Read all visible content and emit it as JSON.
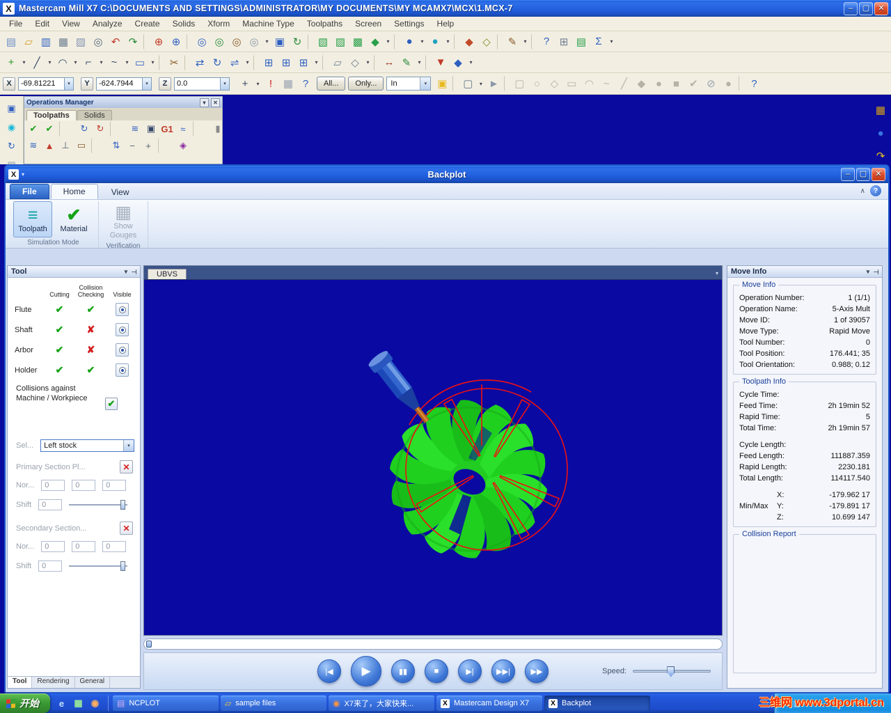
{
  "glyphs": {
    "dd": "▾",
    "pin": "⊤",
    "chevron": "∧",
    "help": "?",
    "min": "–",
    "max": "▢",
    "close": "✕",
    "logo": "X",
    "qa_arrow": "▾",
    "check": "✔"
  },
  "main_window": {
    "title": "Mastercam Mill X7   C:\\DOCUMENTS AND SETTINGS\\ADMINISTRATOR\\MY DOCUMENTS\\MY MCAMX7\\MCX\\1.MCX-7",
    "menus": [
      "File",
      "Edit",
      "View",
      "Analyze",
      "Create",
      "Solids",
      "Xform",
      "Machine Type",
      "Toolpaths",
      "Screen",
      "Settings",
      "Help"
    ]
  },
  "toolbars": {
    "row1": [
      {
        "name": "new-file-button",
        "glyph": "▤",
        "color": "#6f8fc9"
      },
      {
        "name": "open-file-button",
        "glyph": "▱",
        "color": "#d79a2b"
      },
      {
        "name": "save-button",
        "glyph": "▥",
        "color": "#2f5fc0"
      },
      {
        "name": "print-button",
        "glyph": "▦",
        "color": "#6d7d90"
      },
      {
        "name": "copy-button",
        "glyph": "▨",
        "color": "#8795b5"
      },
      {
        "name": "find-button",
        "glyph": "◎",
        "color": "#55657a"
      },
      {
        "name": "undo-button",
        "glyph": "↶",
        "color": "#c23a2a"
      },
      {
        "name": "redo-button",
        "glyph": "↷",
        "color": "#2a8a3a"
      },
      {
        "cls": "sep",
        "name": "toolbar-separator"
      },
      {
        "name": "analyze-position-button",
        "glyph": "⊕",
        "color": "#c23a2a"
      },
      {
        "name": "analyze-entity-button",
        "glyph": "⊕",
        "color": "#2f5fc0"
      },
      {
        "cls": "sep",
        "name": "toolbar-separator"
      },
      {
        "name": "zoom-window-button",
        "glyph": "◎",
        "color": "#2f5fc0"
      },
      {
        "name": "zoom-in-button",
        "glyph": "◎",
        "color": "#2a8a3a"
      },
      {
        "name": "zoom-out-button",
        "glyph": "◎",
        "color": "#8a5a2a"
      },
      {
        "name": "unzoom-button",
        "glyph": "◎",
        "color": "#8b98a8"
      },
      {
        "cls": "dd",
        "name": "zoom-dropdown",
        "glyph": "▾"
      },
      {
        "name": "fit-screen-button",
        "glyph": "▣",
        "color": "#2f5fc0"
      },
      {
        "name": "repaint-button",
        "glyph": "↻",
        "color": "#2a8a3a"
      },
      {
        "cls": "sep",
        "name": "toolbar-separator"
      },
      {
        "name": "gview-top-button",
        "glyph": "▧",
        "color": "#2aa04a"
      },
      {
        "name": "gview-front-button",
        "glyph": "▨",
        "color": "#2aa04a"
      },
      {
        "name": "gview-side-button",
        "glyph": "▩",
        "color": "#2aa04a"
      },
      {
        "name": "gview-iso-button",
        "glyph": "◆",
        "color": "#2aa04a"
      },
      {
        "cls": "dd",
        "name": "gview-dropdown",
        "glyph": "▾"
      },
      {
        "cls": "sep",
        "name": "toolbar-separator"
      },
      {
        "name": "planes-button",
        "glyph": "●",
        "color": "#2f5fc0"
      },
      {
        "cls": "dd",
        "name": "planes-dropdown",
        "glyph": "▾"
      },
      {
        "name": "wcs-button",
        "glyph": "●",
        "color": "#20a0c0"
      },
      {
        "cls": "dd",
        "name": "wcs-dropdown",
        "glyph": "▾"
      },
      {
        "cls": "sep",
        "name": "toolbar-separator"
      },
      {
        "name": "shading-button",
        "glyph": "◆",
        "color": "#c24a2a"
      },
      {
        "name": "wireframe-button",
        "glyph": "◇",
        "color": "#8a8a2a"
      },
      {
        "cls": "sep",
        "name": "toolbar-separator"
      },
      {
        "name": "attributes-button",
        "glyph": "✎",
        "color": "#8a5a2a"
      },
      {
        "cls": "dd",
        "name": "attributes-dropdown",
        "glyph": "▾"
      },
      {
        "cls": "sep",
        "name": "toolbar-separator"
      },
      {
        "name": "help-button",
        "glyph": "?",
        "color": "#2f5fc0"
      },
      {
        "name": "grid-params-button",
        "glyph": "⊞",
        "color": "#6d7d90"
      },
      {
        "name": "mcx-utility-button",
        "glyph": "▤",
        "color": "#2aa04a"
      },
      {
        "name": "sigma-button",
        "glyph": "Σ",
        "color": "#2f5fc0"
      },
      {
        "cls": "dd",
        "name": "more-dropdown",
        "glyph": "▾"
      }
    ],
    "row2": [
      {
        "name": "create-point-button",
        "glyph": "+",
        "color": "#2a9a2a"
      },
      {
        "cls": "dd",
        "name": "create-point-dropdown",
        "glyph": "▾"
      },
      {
        "name": "create-line-button",
        "glyph": "╱",
        "color": "#35486a"
      },
      {
        "cls": "dd",
        "name": "create-line-dropdown",
        "glyph": "▾"
      },
      {
        "name": "create-arc-button",
        "glyph": "◠",
        "color": "#35486a"
      },
      {
        "cls": "dd",
        "name": "create-arc-dropdown",
        "glyph": "▾"
      },
      {
        "name": "create-fillet-button",
        "glyph": "⌐",
        "color": "#35486a"
      },
      {
        "cls": "dd",
        "name": "create-fillet-dropdown",
        "glyph": "▾"
      },
      {
        "name": "create-spline-button",
        "glyph": "~",
        "color": "#35486a"
      },
      {
        "cls": "dd",
        "name": "create-spline-dropdown",
        "glyph": "▾"
      },
      {
        "name": "create-rect-button",
        "glyph": "▭",
        "color": "#2f5fc0"
      },
      {
        "cls": "dd",
        "name": "create-rect-dropdown",
        "glyph": "▾"
      },
      {
        "cls": "sep",
        "name": "toolbar-separator"
      },
      {
        "name": "trim-button",
        "glyph": "✂",
        "color": "#8a5a2a"
      },
      {
        "cls": "sep",
        "name": "toolbar-separator"
      },
      {
        "name": "xform-translate-button",
        "glyph": "⇄",
        "color": "#2f5fc0"
      },
      {
        "name": "xform-rotate-button",
        "glyph": "↻",
        "color": "#2f5fc0"
      },
      {
        "name": "xform-mirror-button",
        "glyph": "⇌",
        "color": "#2f5fc0"
      },
      {
        "cls": "dd",
        "name": "xform-dropdown",
        "glyph": "▾"
      },
      {
        "cls": "sep",
        "name": "toolbar-separator"
      },
      {
        "name": "levels-button",
        "glyph": "⊞",
        "color": "#2f5fc0"
      },
      {
        "name": "level-manager-button",
        "glyph": "⊞",
        "color": "#2f5fc0"
      },
      {
        "name": "level-set-button",
        "glyph": "⊞",
        "color": "#2f5fc0"
      },
      {
        "cls": "dd",
        "name": "levels-dropdown",
        "glyph": "▾"
      },
      {
        "cls": "sep",
        "name": "toolbar-separator"
      },
      {
        "name": "cplane-button",
        "glyph": "▱",
        "color": "#6d7d90"
      },
      {
        "name": "vplane-button",
        "glyph": "◇",
        "color": "#6d7d90"
      },
      {
        "cls": "dd",
        "name": "plane-dropdown",
        "glyph": "▾"
      },
      {
        "cls": "sep",
        "name": "toolbar-separator"
      },
      {
        "name": "dimension-button",
        "glyph": "↔",
        "color": "#a23a2a"
      },
      {
        "name": "note-button",
        "glyph": "✎",
        "color": "#2a8a3a"
      },
      {
        "cls": "dd",
        "name": "drafting-dropdown",
        "glyph": "▾"
      },
      {
        "cls": "sep",
        "name": "toolbar-separator"
      },
      {
        "name": "solids-button",
        "glyph": "▼",
        "color": "#c23a2a"
      },
      {
        "name": "surface-button",
        "glyph": "◆",
        "color": "#2f5fc0"
      },
      {
        "cls": "dd",
        "name": "model-dropdown",
        "glyph": "▾"
      }
    ],
    "coord": {
      "x_label": "X",
      "x_value": "-69.81221",
      "y_label": "Y",
      "y_value": "-624.7944",
      "z_label": "Z",
      "z_value": "0.0",
      "all_button": "All...",
      "only_button": "Only...",
      "in_value": "In"
    },
    "coord_icons": [
      {
        "name": "autocursor-button",
        "glyph": "+",
        "color": "#35486a"
      },
      {
        "cls": "dd",
        "name": "autocursor-dropdown",
        "glyph": "▾"
      },
      {
        "name": "fastpoint-button",
        "glyph": "!",
        "color": "#d02020"
      },
      {
        "name": "grid-toggle-button",
        "glyph": "▦",
        "color": "#98a2b0"
      },
      {
        "name": "config-button",
        "glyph": "?",
        "color": "#2f5fc0"
      }
    ],
    "select_icons": [
      {
        "name": "highlight-button",
        "glyph": "▣",
        "color": "#e8b820"
      },
      {
        "cls": "sep",
        "name": "toolbar-separator"
      },
      {
        "name": "select-box-button",
        "glyph": "▢",
        "color": "#66788c"
      },
      {
        "cls": "dd",
        "name": "select-box-dropdown",
        "glyph": "▾"
      },
      {
        "name": "select-cursor-button",
        "glyph": "►",
        "color": "#8b98a8"
      },
      {
        "cls": "sep",
        "name": "toolbar-separator"
      },
      {
        "name": "filter-square-button",
        "glyph": "▢",
        "color": "#b6b2a4"
      },
      {
        "name": "filter-circle-button",
        "glyph": "○",
        "color": "#b6b2a4"
      },
      {
        "name": "filter-diamond-button",
        "glyph": "◇",
        "color": "#b6b2a4"
      },
      {
        "name": "filter-rect-button",
        "glyph": "▭",
        "color": "#b6b2a4"
      },
      {
        "name": "filter-arc-button",
        "glyph": "◠",
        "color": "#b6b2a4"
      },
      {
        "name": "filter-spline-button",
        "glyph": "~",
        "color": "#b6b2a4"
      },
      {
        "name": "filter-line-button",
        "glyph": "╱",
        "color": "#b6b2a4"
      },
      {
        "name": "filter-solid-button",
        "glyph": "◆",
        "color": "#b6b2a4"
      },
      {
        "name": "filter-surface-button",
        "glyph": "●",
        "color": "#b6b2a4"
      },
      {
        "name": "filter-wire-button",
        "glyph": "■",
        "color": "#b6b2a4"
      },
      {
        "name": "select-last-button",
        "glyph": "✔",
        "color": "#b6b2a4"
      },
      {
        "name": "clear-selection-button",
        "glyph": "⊘",
        "color": "#98a2b0"
      },
      {
        "name": "select-solids-button",
        "glyph": "●",
        "color": "#b6b2a4"
      },
      {
        "cls": "sep",
        "name": "toolbar-separator"
      },
      {
        "name": "selection-help-button",
        "glyph": "?",
        "color": "#2f5fc0"
      }
    ]
  },
  "left_strip": [
    {
      "name": "dock-view-button",
      "glyph": "▣",
      "color": "#2f5fc0"
    },
    {
      "name": "dock-wcs-button",
      "glyph": "◉",
      "color": "#18b8d8"
    },
    {
      "name": "dock-rotate-button",
      "glyph": "↻",
      "color": "#2f5fc0"
    },
    {
      "name": "dock-layers-button",
      "glyph": "▤",
      "color": "#8b98a8"
    }
  ],
  "right_strip": [
    {
      "name": "float-grid-button",
      "glyph": "▦",
      "color": "#d4a017"
    },
    {
      "name": "float-sphere-button",
      "glyph": "●",
      "color": "#3a72e0"
    },
    {
      "name": "float-arrow-button",
      "glyph": "↷",
      "color": "#e8c020"
    }
  ],
  "ops_manager": {
    "title": "Operations Manager",
    "tabs": [
      "Toolpaths",
      "Solids"
    ],
    "toolbar1": [
      {
        "name": "select-all-operations-button",
        "glyph": "✔",
        "color": "#18a018"
      },
      {
        "name": "select-operations-button",
        "glyph": "✔",
        "color": "#18a018"
      },
      {
        "cls": "sep",
        "name": "toolbar-separator"
      },
      {
        "name": "regen-all-button",
        "glyph": "↻",
        "color": "#2f5fc0"
      },
      {
        "name": "regen-dirty-button",
        "glyph": "↻",
        "color": "#c23a2a"
      },
      {
        "cls": "sep",
        "name": "toolbar-separator"
      },
      {
        "name": "backplot-ops-button",
        "glyph": "≋",
        "color": "#2f5fc0"
      },
      {
        "name": "verify-button",
        "glyph": "▣",
        "color": "#35486a"
      },
      {
        "cls": "txt",
        "name": "post-button",
        "glyph": "G1",
        "color": "#c23a2a"
      },
      {
        "name": "highfeed-button",
        "glyph": "≈",
        "color": "#2f5fc0"
      },
      {
        "cls": "sep",
        "name": "toolbar-separator"
      },
      {
        "name": "toolpath-lock-button",
        "glyph": "▮",
        "color": "#8a8a8a"
      },
      {
        "name": "toolpath-display-button",
        "glyph": "≡",
        "color": "#35486a"
      },
      {
        "name": "delete-operations-button",
        "glyph": "✕",
        "color": "#c23a2a"
      },
      {
        "name": "ops-help-button",
        "glyph": "?",
        "color": "#2f5fc0"
      }
    ],
    "toolbar2": [
      {
        "name": "geometry-button",
        "glyph": "≋",
        "color": "#2f5fc0"
      },
      {
        "name": "parameters-button",
        "glyph": "▲",
        "color": "#c23a2a"
      },
      {
        "name": "tool-settings-button",
        "glyph": "⊥",
        "color": "#556070"
      },
      {
        "name": "stock-button",
        "glyph": "▭",
        "color": "#8a5a2a"
      },
      {
        "cls": "sep",
        "name": "toolbar-separator"
      },
      {
        "name": "sort-button",
        "glyph": "⇅",
        "color": "#2f5fc0"
      },
      {
        "name": "collapse-button",
        "glyph": "−",
        "color": "#556070"
      },
      {
        "name": "expand-button",
        "glyph": "+",
        "color": "#556070"
      },
      {
        "cls": "sep",
        "name": "toolbar-separator"
      },
      {
        "name": "info-button",
        "glyph": "◈",
        "color": "#8a2aa0"
      }
    ]
  },
  "backplot": {
    "title": "Backplot",
    "ribbon_tabs": [
      "File",
      "Home",
      "View"
    ],
    "ribbon": {
      "toolpath_icon": "≡",
      "toolpath_label": "Toolpath",
      "material_icon": "✔",
      "material_label": "Material",
      "gouges_icon": "▦",
      "show_gouges_label": "Show Gouges",
      "group_simulation": "Simulation Mode",
      "group_verification": "Verification"
    },
    "tool_panel": {
      "title": "Tool",
      "columns": [
        "Cutting",
        "Collision Checking",
        "Visible"
      ],
      "rows": [
        {
          "label": "Flute",
          "cutting": true,
          "collision": true
        },
        {
          "label": "Shaft",
          "cutting": true,
          "collision": false
        },
        {
          "label": "Arbor",
          "cutting": true,
          "collision": false
        },
        {
          "label": "Holder",
          "cutting": true,
          "collision": true
        }
      ],
      "collisions_text": "Collisions against Machine / Workpiece",
      "collisions_checked": true,
      "select_label": "Sel...",
      "stock_value": "Left stock",
      "primary_section_label": "Primary Section Pl...",
      "nor_label": "Nor...",
      "shift_label": "Shift",
      "field_zero": "0",
      "secondary_section_label": "Secondary Section...",
      "tabs": [
        "Tool",
        "Rendering",
        "General"
      ]
    },
    "viewport": {
      "tab": "UBVS"
    },
    "playback": {
      "buttons": [
        {
          "name": "skip-start-button",
          "glyph": "|◀"
        },
        {
          "name": "play-button",
          "glyph": "▶",
          "cls": "big"
        },
        {
          "name": "pause-button",
          "glyph": "▮▮"
        },
        {
          "name": "stop-button",
          "glyph": "■"
        },
        {
          "name": "step-forward-button",
          "glyph": "▶|"
        },
        {
          "name": "skip-end-button",
          "glyph": "▶▶|"
        },
        {
          "name": "fast-forward-button",
          "glyph": "▶▶"
        }
      ],
      "speed_label": "Speed:"
    },
    "move_info": {
      "panel_title": "Move Info",
      "group1_title": "Move Info",
      "move_rows": [
        {
          "label": "Operation Number:",
          "value": "1 (1/1)"
        },
        {
          "label": "Operation Name:",
          "value": "5-Axis Mult"
        },
        {
          "label": "Move ID:",
          "value": "1 of 39057"
        },
        {
          "label": "Move Type:",
          "value": "Rapid Move"
        },
        {
          "label": "Tool Number:",
          "value": "0"
        },
        {
          "label": "Tool Position:",
          "value": "176.441; 35"
        },
        {
          "label": "Tool Orientation:",
          "value": "0.988; 0.12"
        }
      ],
      "group2_title": "Toolpath Info",
      "toolpath_rows": [
        {
          "label": "Cycle Time:",
          "value": ""
        },
        {
          "label": "Feed Time:",
          "value": "2h 19min 52"
        },
        {
          "label": "Rapid Time:",
          "value": "5"
        },
        {
          "label": "Total Time:",
          "value": "2h 19min 57"
        },
        {
          "cls": "gap",
          "label": "",
          "value": ""
        },
        {
          "label": "Cycle Length:",
          "value": ""
        },
        {
          "label": "Feed Length:",
          "value": "111887.359"
        },
        {
          "label": "Rapid Length:",
          "value": "2230.181"
        },
        {
          "label": "Total Length:",
          "value": "114117.540"
        },
        {
          "cls": "gap",
          "label": "",
          "value": ""
        },
        {
          "cls": "xyz",
          "pre": "",
          "label": "X:",
          "value": "-179.962 17"
        },
        {
          "cls": "xyz",
          "pre": "Min/Max",
          "label": "Y:",
          "value": "-179.891 17"
        },
        {
          "cls": "xyz",
          "pre": "",
          "label": "Z:",
          "value": "10.699 147"
        }
      ],
      "group3_title": "Collision Report"
    }
  },
  "taskbar": {
    "start_label": "开始",
    "quick_launch": [
      {
        "name": "quicklaunch-ie",
        "glyph": "e",
        "color": "#bfe0ff"
      },
      {
        "name": "quicklaunch-desktop",
        "glyph": "▦",
        "color": "#9ae89a"
      },
      {
        "name": "quicklaunch-media",
        "glyph": "◉",
        "color": "#ffb060"
      }
    ],
    "tasks": [
      {
        "name": "task-ncplot",
        "icon": "▤",
        "label": "NCPLOT",
        "cls": "t-np"
      },
      {
        "name": "task-sample-files",
        "icon": "▱",
        "label": "sample files",
        "cls": "t-folder"
      },
      {
        "name": "task-forum-page",
        "icon": "◉",
        "label": "X7来了，大家快来...",
        "cls": "t-web"
      },
      {
        "name": "task-mastercam-design",
        "icon": "X",
        "label": "Mastercam Design X7",
        "cls": "t-x"
      },
      {
        "name": "task-backplot",
        "icon": "X",
        "label": "Backplot",
        "cls": "t-x active"
      }
    ],
    "tray_icons": [
      {
        "name": "tray-volume-icon",
        "glyph": "♪"
      },
      {
        "name": "tray-network-icon",
        "glyph": "▥"
      },
      {
        "name": "tray-shield-icon",
        "glyph": "●"
      }
    ],
    "watermark": "三维网 www.3dportal.cn"
  }
}
